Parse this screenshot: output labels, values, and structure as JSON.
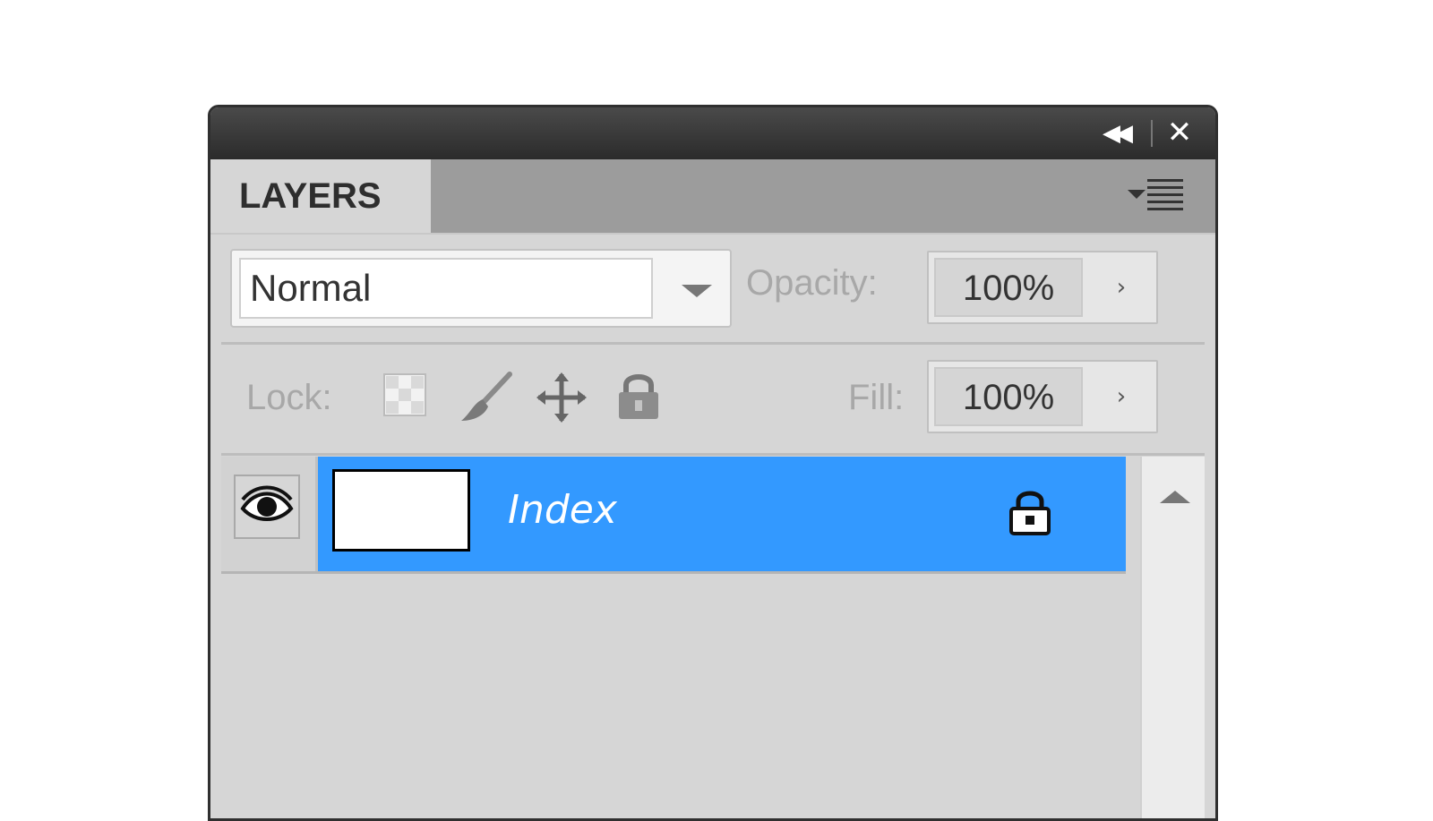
{
  "panel": {
    "collapse_glyph": "◀◀",
    "close_glyph": "✕",
    "tab_label": "LAYERS"
  },
  "blend_mode": {
    "value": "Normal"
  },
  "opacity": {
    "label": "Opacity:",
    "value": "100%",
    "step_glyph": "›"
  },
  "lock": {
    "label": "Lock:",
    "icons": [
      "lock-transparent-pixels-icon",
      "lock-image-pixels-icon",
      "lock-position-icon",
      "lock-all-icon"
    ]
  },
  "fill": {
    "label": "Fill:",
    "value": "100%",
    "step_glyph": "›"
  },
  "layers": [
    {
      "name": "Index",
      "visible": true,
      "locked": true,
      "selected": true
    }
  ],
  "colors": {
    "titlebar": "#2b2b2b",
    "panel_bg": "#d6d6d6",
    "selected_row": "#3399ff"
  }
}
